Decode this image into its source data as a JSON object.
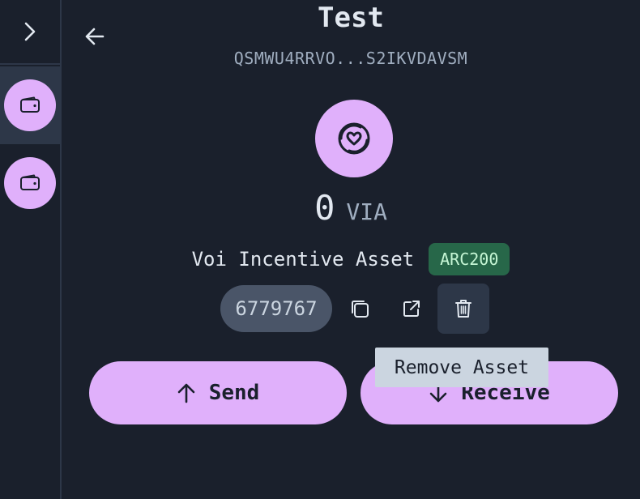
{
  "sidebar": {
    "toggle_icon": "chevron-right-icon",
    "accounts": [
      {
        "icon": "wallet-icon",
        "active": true
      },
      {
        "icon": "wallet-icon",
        "active": false
      }
    ]
  },
  "header": {
    "back_icon": "arrow-left-icon",
    "account_name": "Test",
    "address": "QSMWU4RRVO...S2IKVDAVSM"
  },
  "asset": {
    "logo_icon": "voi-logo-icon",
    "balance": "0",
    "unit": "VIA",
    "name": "Voi Incentive Asset",
    "standard_badge": "ARC200",
    "id": "6779767",
    "actions": [
      {
        "icon": "copy-icon"
      },
      {
        "icon": "external-link-icon"
      },
      {
        "icon": "trash-icon"
      }
    ]
  },
  "buttons": {
    "send_label": "Send",
    "receive_label": "Receive"
  },
  "tooltip": {
    "text": "Remove Asset"
  },
  "colors": {
    "background": "#1a202c",
    "accent": "#e0b0fb",
    "badge_bg": "#276749",
    "badge_text": "#c6f6d5"
  }
}
